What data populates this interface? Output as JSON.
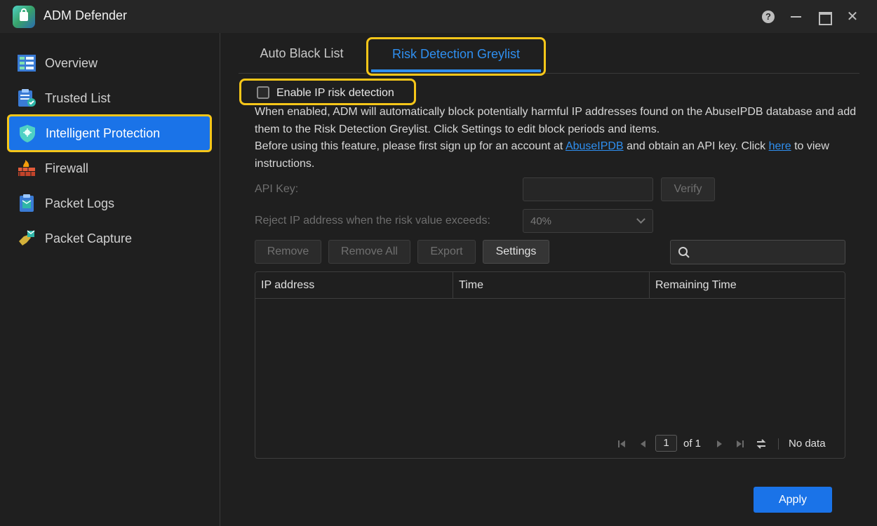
{
  "window": {
    "title": "ADM Defender"
  },
  "sidebar": {
    "items": [
      {
        "label": "Overview",
        "icon": "overview-icon"
      },
      {
        "label": "Trusted List",
        "icon": "trusted-list-icon"
      },
      {
        "label": "Intelligent Protection",
        "icon": "shield-icon",
        "active": true
      },
      {
        "label": "Firewall",
        "icon": "firewall-icon"
      },
      {
        "label": "Packet Logs",
        "icon": "packet-logs-icon"
      },
      {
        "label": "Packet Capture",
        "icon": "packet-capture-icon"
      }
    ]
  },
  "tabs": [
    {
      "label": "Auto Black List"
    },
    {
      "label": "Risk Detection Greylist",
      "active": true
    }
  ],
  "enable": {
    "label": "Enable IP risk detection",
    "checked": false
  },
  "description": {
    "line1": "When enabled, ADM will automatically block potentially harmful IP addresses found on the AbuseIPDB database and add them to the Risk Detection Greylist. Click Settings to edit block periods and items.",
    "line2_before": "Before using this feature, please first sign up for an account at ",
    "link1": "AbuseIPDB",
    "line2_mid": " and obtain an API key. Click ",
    "link2": "here",
    "line2_after": " to view instructions."
  },
  "form": {
    "api_key_label": "API Key:",
    "api_key_value": "",
    "verify_label": "Verify",
    "reject_label": "Reject IP address when the risk value exceeds:",
    "reject_value": "40%"
  },
  "toolbar": {
    "remove": "Remove",
    "remove_all": "Remove All",
    "export": "Export",
    "settings": "Settings",
    "search_placeholder": ""
  },
  "table": {
    "columns": [
      "IP address",
      "Time",
      "Remaining Time"
    ],
    "rows": []
  },
  "pager": {
    "page": "1",
    "of": "of 1",
    "status": "No data"
  },
  "footer": {
    "apply": "Apply"
  },
  "colors": {
    "accent": "#1a73e8",
    "highlight": "#f6c619",
    "link": "#2f8ff0"
  }
}
